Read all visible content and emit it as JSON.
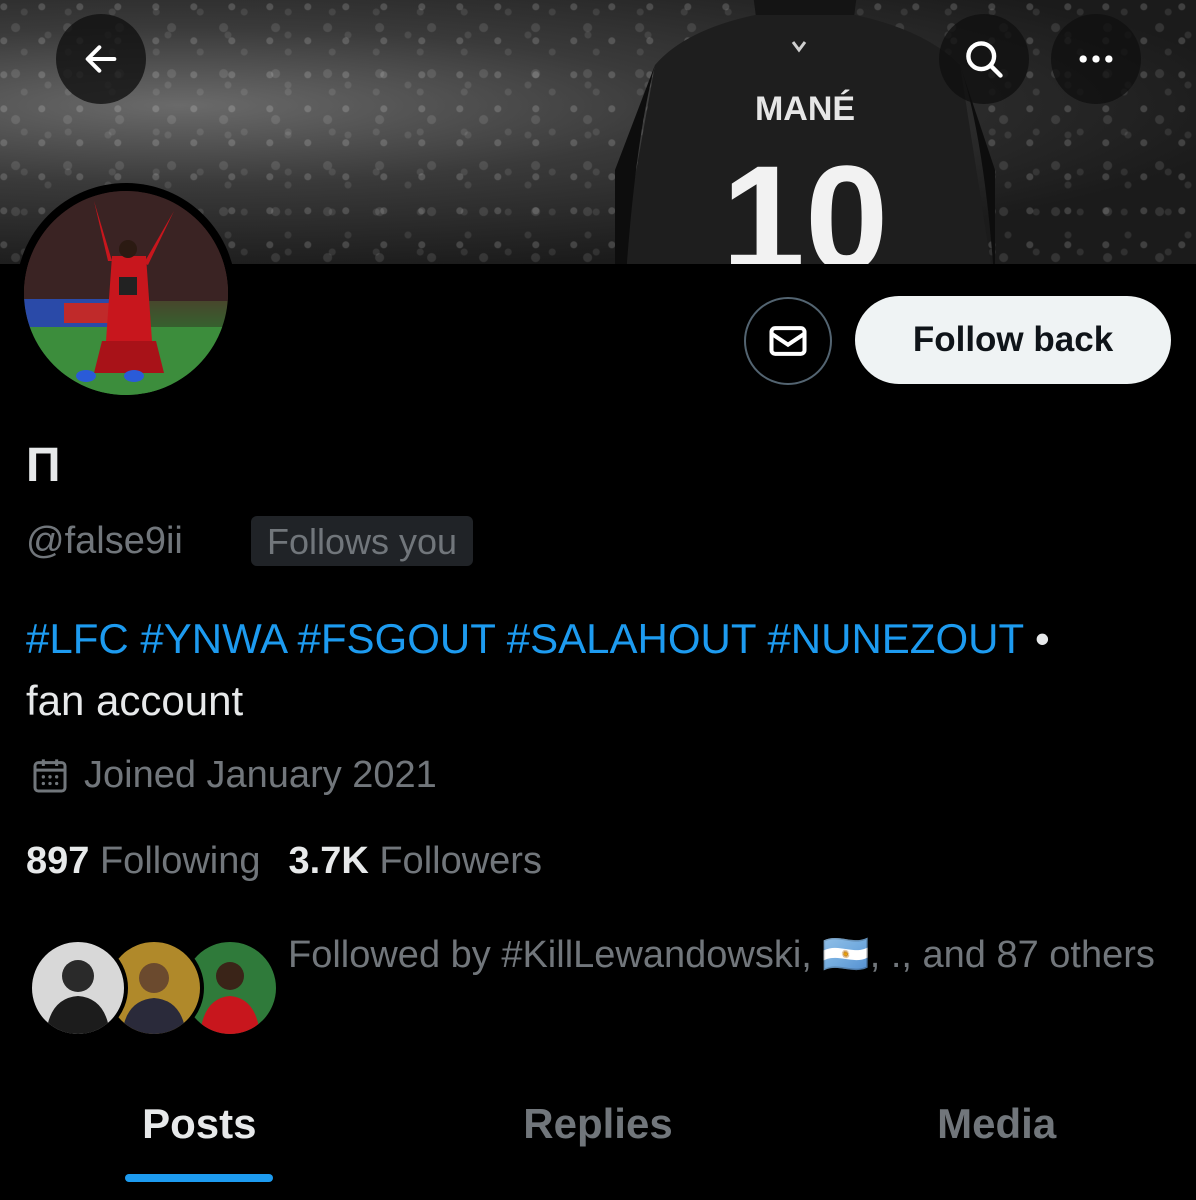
{
  "banner": {
    "jersey_name": "MANÉ",
    "jersey_number": "10"
  },
  "nav": {
    "back_icon": "arrow-left-icon",
    "search_icon": "search-icon",
    "more_icon": "more-horizontal-icon"
  },
  "actions": {
    "message_icon": "envelope-icon",
    "follow_label": "Follow back"
  },
  "profile": {
    "display_name": "П",
    "handle": "@false9ii",
    "follows_you": "Follows you",
    "bio_tags": "#LFC #YNWA #FSGOUT #SALAHOUT #NUNEZOUT",
    "bio_sep": " •",
    "bio_text": "fan account",
    "joined": "Joined January 2021",
    "following_count": "897",
    "following_label": "Following",
    "followers_count": "3.7K",
    "followers_label": "Followers",
    "followed_by_prefix": "Followed by #KillLewandowski, ",
    "followed_by_flag": "🇦🇷",
    "followed_by_suffix": ", ., and 87 others"
  },
  "tabs": [
    {
      "label": "Posts",
      "active": true
    },
    {
      "label": "Replies",
      "active": false
    },
    {
      "label": "Media",
      "active": false
    }
  ],
  "colors": {
    "accent": "#1d9bf0",
    "muted": "#71767b",
    "text": "#e7e9ea",
    "background": "#000000"
  }
}
